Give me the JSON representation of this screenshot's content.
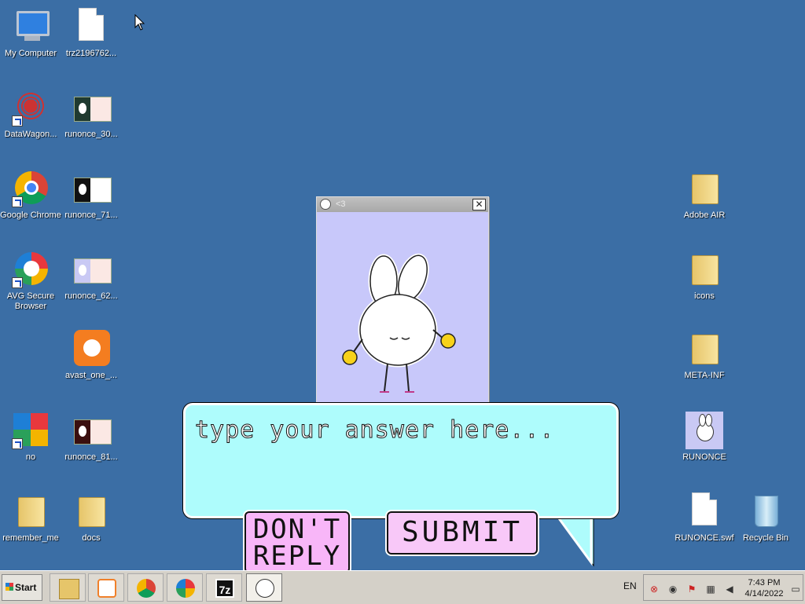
{
  "desktop": {
    "icons": [
      {
        "label": "My Computer"
      },
      {
        "label": "trz2196762..."
      },
      {
        "label": "DataWagon..."
      },
      {
        "label": "runonce_30..."
      },
      {
        "label": "Google Chrome"
      },
      {
        "label": "runonce_71..."
      },
      {
        "label": "AVG Secure Browser"
      },
      {
        "label": "runonce_62..."
      },
      {
        "label": "avast_one_..."
      },
      {
        "label": "no"
      },
      {
        "label": "runonce_81..."
      },
      {
        "label": "remember_me"
      },
      {
        "label": "docs"
      },
      {
        "label": "Adobe AIR"
      },
      {
        "label": "icons"
      },
      {
        "label": "META-INF"
      },
      {
        "label": "RUNONCE"
      },
      {
        "label": "RUNONCE.swf"
      },
      {
        "label": "Recycle Bin"
      }
    ]
  },
  "popup": {
    "title": "<3",
    "close_glyph": "✕"
  },
  "bubble": {
    "placeholder": "type your answer here...",
    "answer_value": ""
  },
  "buttons": {
    "dont_reply": "DON'T REPLY",
    "submit": "SUBMIT"
  },
  "taskbar": {
    "start_label": "Start",
    "seven_zip_label": "7z",
    "language": "EN",
    "time": "7:43 PM",
    "date": "4/14/2022"
  }
}
